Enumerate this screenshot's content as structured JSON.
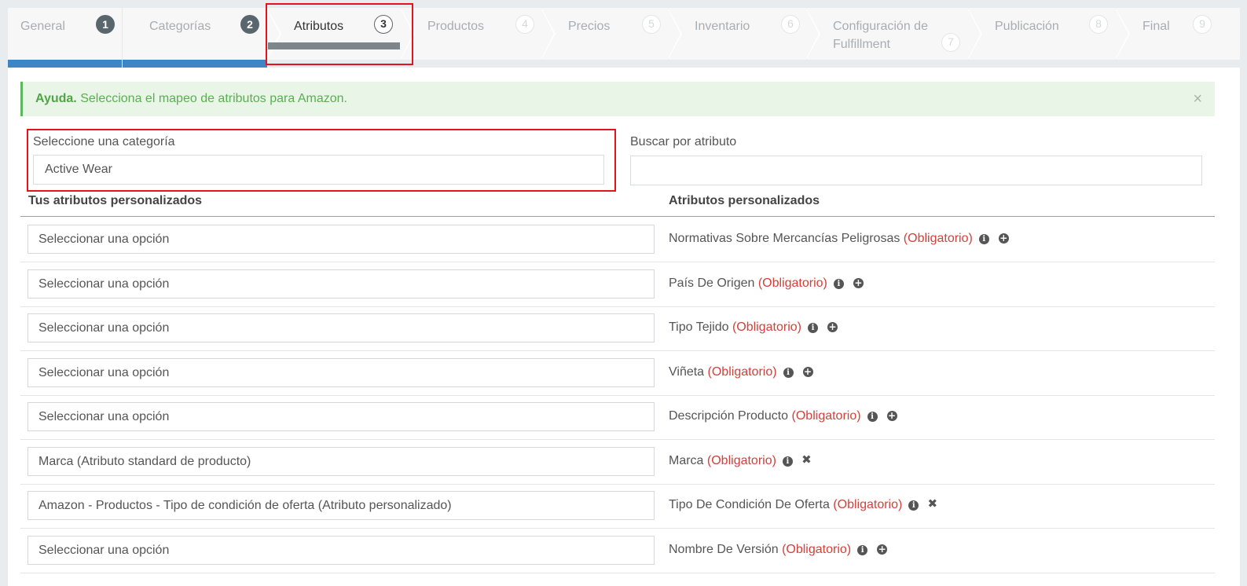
{
  "wizard": {
    "steps": [
      {
        "label": "General",
        "num": "1",
        "state": "done"
      },
      {
        "label": "Categorías",
        "num": "2",
        "state": "done"
      },
      {
        "label": "Atributos",
        "num": "3",
        "state": "active"
      },
      {
        "label": "Productos",
        "num": "4",
        "state": "todo"
      },
      {
        "label": "Precios",
        "num": "5",
        "state": "todo"
      },
      {
        "label": "Inventario",
        "num": "6",
        "state": "todo"
      },
      {
        "label": "Configuración de Fulfillment",
        "num": "7",
        "state": "todo"
      },
      {
        "label": "Publicación",
        "num": "8",
        "state": "todo"
      },
      {
        "label": "Final",
        "num": "9",
        "state": "todo"
      }
    ]
  },
  "alert": {
    "title": "Ayuda.",
    "text": "Selecciona el mapeo de atributos para Amazon.",
    "close": "×"
  },
  "category": {
    "label": "Seleccione una categoría",
    "value": "Active Wear"
  },
  "search": {
    "label": "Buscar por atributo",
    "value": ""
  },
  "table": {
    "left_header": "Tus atributos personalizados",
    "right_header": "Atributos personalizados",
    "required_text": "(Obligatorio)",
    "rows": [
      {
        "select": "Seleccionar una opción",
        "attr": "Normativas Sobre Mercancías Peligrosas",
        "action": "add"
      },
      {
        "select": "Seleccionar una opción",
        "attr": "País De Origen",
        "action": "add"
      },
      {
        "select": "Seleccionar una opción",
        "attr": "Tipo Tejido",
        "action": "add"
      },
      {
        "select": "Seleccionar una opción",
        "attr": "Viñeta",
        "action": "add"
      },
      {
        "select": "Seleccionar una opción",
        "attr": "Descripción Producto",
        "action": "add"
      },
      {
        "select": "Marca (Atributo standard de producto)",
        "attr": "Marca",
        "action": "remove"
      },
      {
        "select": "Amazon - Productos - Tipo de condición de oferta (Atributo personalizado)",
        "attr": "Tipo De Condición De Oferta",
        "action": "remove"
      },
      {
        "select": "Seleccionar una opción",
        "attr": "Nombre De Versión",
        "action": "add"
      }
    ]
  },
  "colors": {
    "done_bar": "#3c86c8",
    "active_bar": "#7c868c",
    "required": "#d43f3a",
    "highlight": "#e3141c"
  }
}
